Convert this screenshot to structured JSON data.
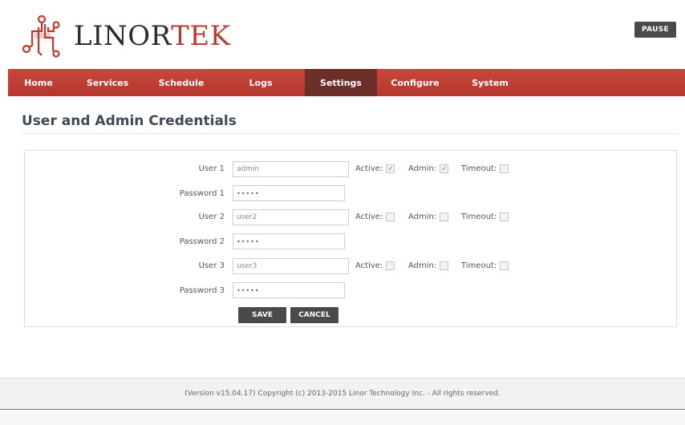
{
  "brand": {
    "name_part1": "LINOR",
    "name_part2": "TEK",
    "accent_color": "#c0392b",
    "icon": "circuit-logo-icon"
  },
  "header": {
    "pause_label": "PAUSE"
  },
  "nav": {
    "items": [
      {
        "label": "Home"
      },
      {
        "label": "Services"
      },
      {
        "label": "Schedule"
      },
      {
        "label": "Logs"
      },
      {
        "label": "Settings",
        "active": true
      },
      {
        "label": "Configure"
      },
      {
        "label": "System"
      }
    ],
    "bar_color": "#b9392f",
    "active_color": "#6b2e28"
  },
  "page": {
    "title": "User and Admin Credentials"
  },
  "flag_labels": {
    "active": "Active:",
    "admin": "Admin:",
    "timeout": "Timeout:"
  },
  "users": [
    {
      "user_label": "User 1",
      "username": "admin",
      "password_label": "Password 1",
      "password": "•••••",
      "active": true,
      "admin": true,
      "timeout": false
    },
    {
      "user_label": "User 2",
      "username": "user2",
      "password_label": "Password 2",
      "password": "•••••",
      "active": false,
      "admin": false,
      "timeout": false
    },
    {
      "user_label": "User 3",
      "username": "user3",
      "password_label": "Password 3",
      "password": "•••••",
      "active": false,
      "admin": false,
      "timeout": false
    }
  ],
  "actions": {
    "save_label": "SAVE",
    "cancel_label": "CANCEL"
  },
  "footer": {
    "text": "(Version v15.04.17) Copyright (c) 2013-2015 Linor Technology Inc. - All rights reserved."
  }
}
